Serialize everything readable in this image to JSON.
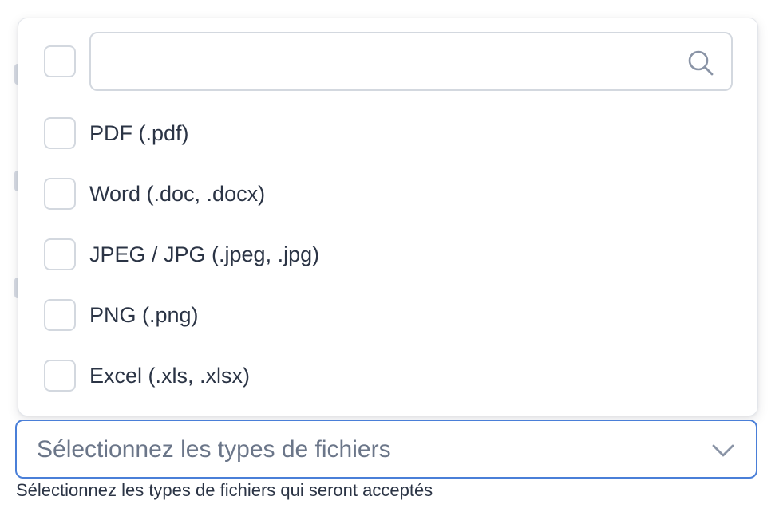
{
  "search": {
    "value": "",
    "placeholder": ""
  },
  "options": [
    {
      "label": "PDF (.pdf)",
      "checked": false
    },
    {
      "label": "Word (.doc, .docx)",
      "checked": false
    },
    {
      "label": "JPEG / JPG (.jpeg, .jpg)",
      "checked": false
    },
    {
      "label": "PNG (.png)",
      "checked": false
    },
    {
      "label": "Excel (.xls, .xlsx)",
      "checked": false
    }
  ],
  "select": {
    "placeholder": "Sélectionnez les types de fichiers"
  },
  "help_text": "Sélectionnez les types de fichiers qui seront acceptés",
  "colors": {
    "focus_border": "#4a7fd8",
    "checkbox_border": "#d3d8df",
    "text": "#2b3445",
    "placeholder": "#6b7689"
  },
  "icons": {
    "search": "search-icon",
    "chevron": "chevron-down-icon"
  }
}
